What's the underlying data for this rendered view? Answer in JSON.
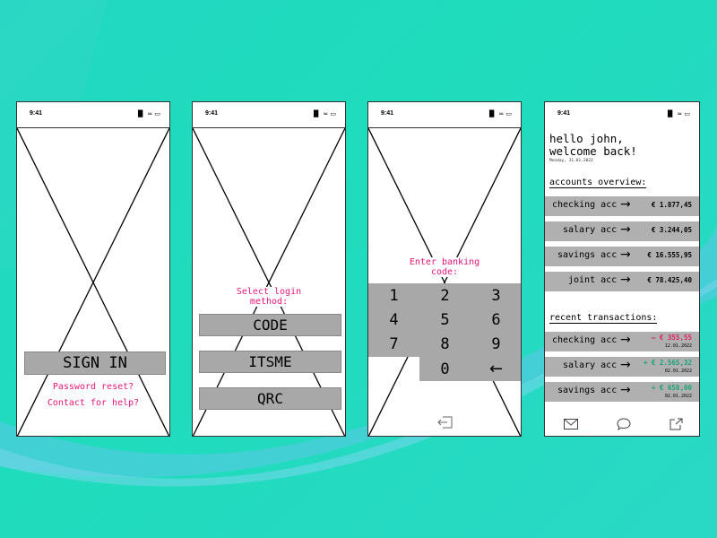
{
  "status": {
    "time": "9:41",
    "icons": "▐▌ ≈ ▭"
  },
  "screen1": {
    "sign_in": "SIGN IN",
    "password_reset": "Password reset?",
    "contact_help": "Contact for help?"
  },
  "screen2": {
    "prompt": "Select login method:",
    "methods": [
      "CODE",
      "ITSME",
      "QRC"
    ]
  },
  "screen3": {
    "prompt": "Enter banking code:",
    "keys": [
      "1",
      "2",
      "3",
      "4",
      "5",
      "6",
      "7",
      "8",
      "9",
      "0"
    ],
    "backspace": "←",
    "logout_icon": "logout-icon"
  },
  "screen4": {
    "greeting_line1": "hello john,",
    "greeting_line2": "welcome back!",
    "date": "Monday, 31.01.2022",
    "accounts_header": "accounts overview:",
    "accounts": [
      {
        "name": "checking acc",
        "amount": "€ 1.877,45"
      },
      {
        "name": "salary acc",
        "amount": "€ 3.244,05"
      },
      {
        "name": "savings acc",
        "amount": "€ 16.555,95"
      },
      {
        "name": "joint acc",
        "amount": "€ 78.425,40"
      }
    ],
    "transactions_header": "recent transactions:",
    "transactions": [
      {
        "name": "checking acc",
        "amount": "– € 355,55",
        "date": "12.01.2022",
        "color": "#e0245e"
      },
      {
        "name": "salary acc",
        "amount": "+ € 2.565,32",
        "date": "02.01.2022",
        "color": "#1aa37a"
      },
      {
        "name": "savings acc",
        "amount": "+ € 658,00",
        "date": "02.01.2022",
        "color": "#1aa37a"
      }
    ],
    "arrow": "→",
    "nav": {
      "mail": "mail-icon",
      "chat": "chat-icon",
      "share": "share-icon"
    }
  },
  "colors": {
    "accent_pink": "#e8147a",
    "button_gray": "#a8a8a8",
    "negative": "#e0245e",
    "positive": "#1aa37a"
  }
}
